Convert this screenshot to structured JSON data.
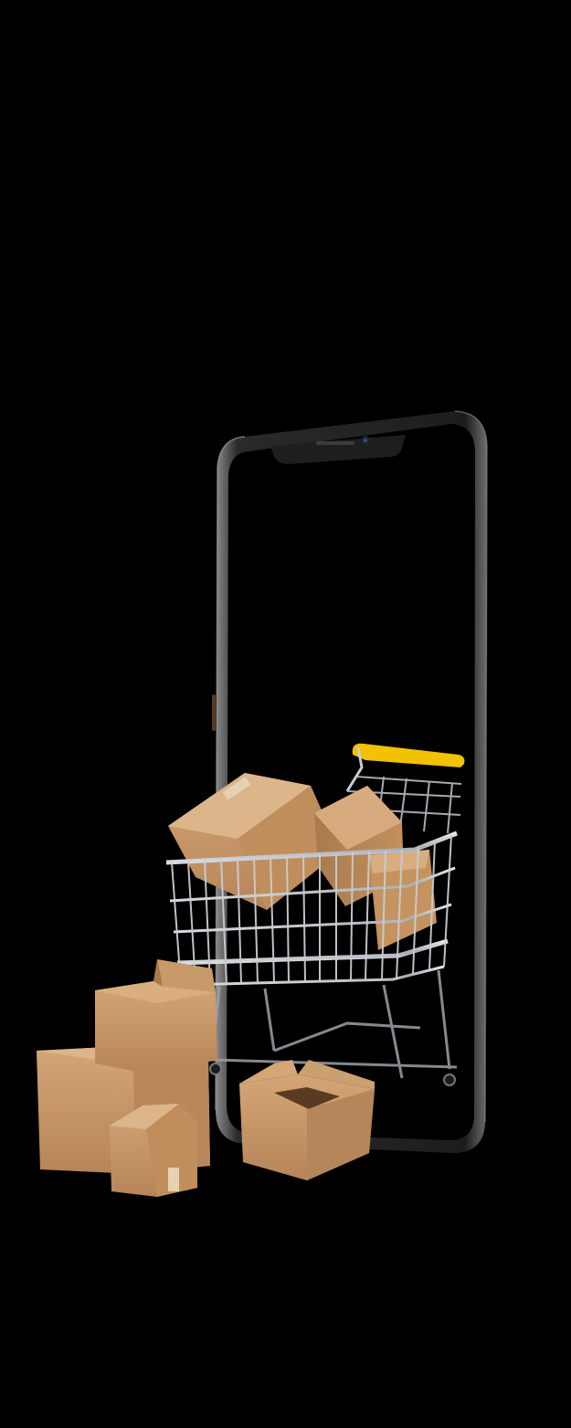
{
  "scene": {
    "background_color": "#000000",
    "phone_frame_color": "#2a2a2a",
    "phone_edge_highlight": "#8a8a8a",
    "screen_color": "#000000",
    "cart_metal_color": "#c9ccd1",
    "cart_handle_color": "#f2c200",
    "box_color": "#c89a6a",
    "box_shadow_color": "#9b7047",
    "box_highlight_color": "#ddb58b",
    "tape_color": "#e6d2b3",
    "icons": [
      "smartphone-icon",
      "shopping-cart-icon",
      "cardboard-box-icon"
    ]
  }
}
